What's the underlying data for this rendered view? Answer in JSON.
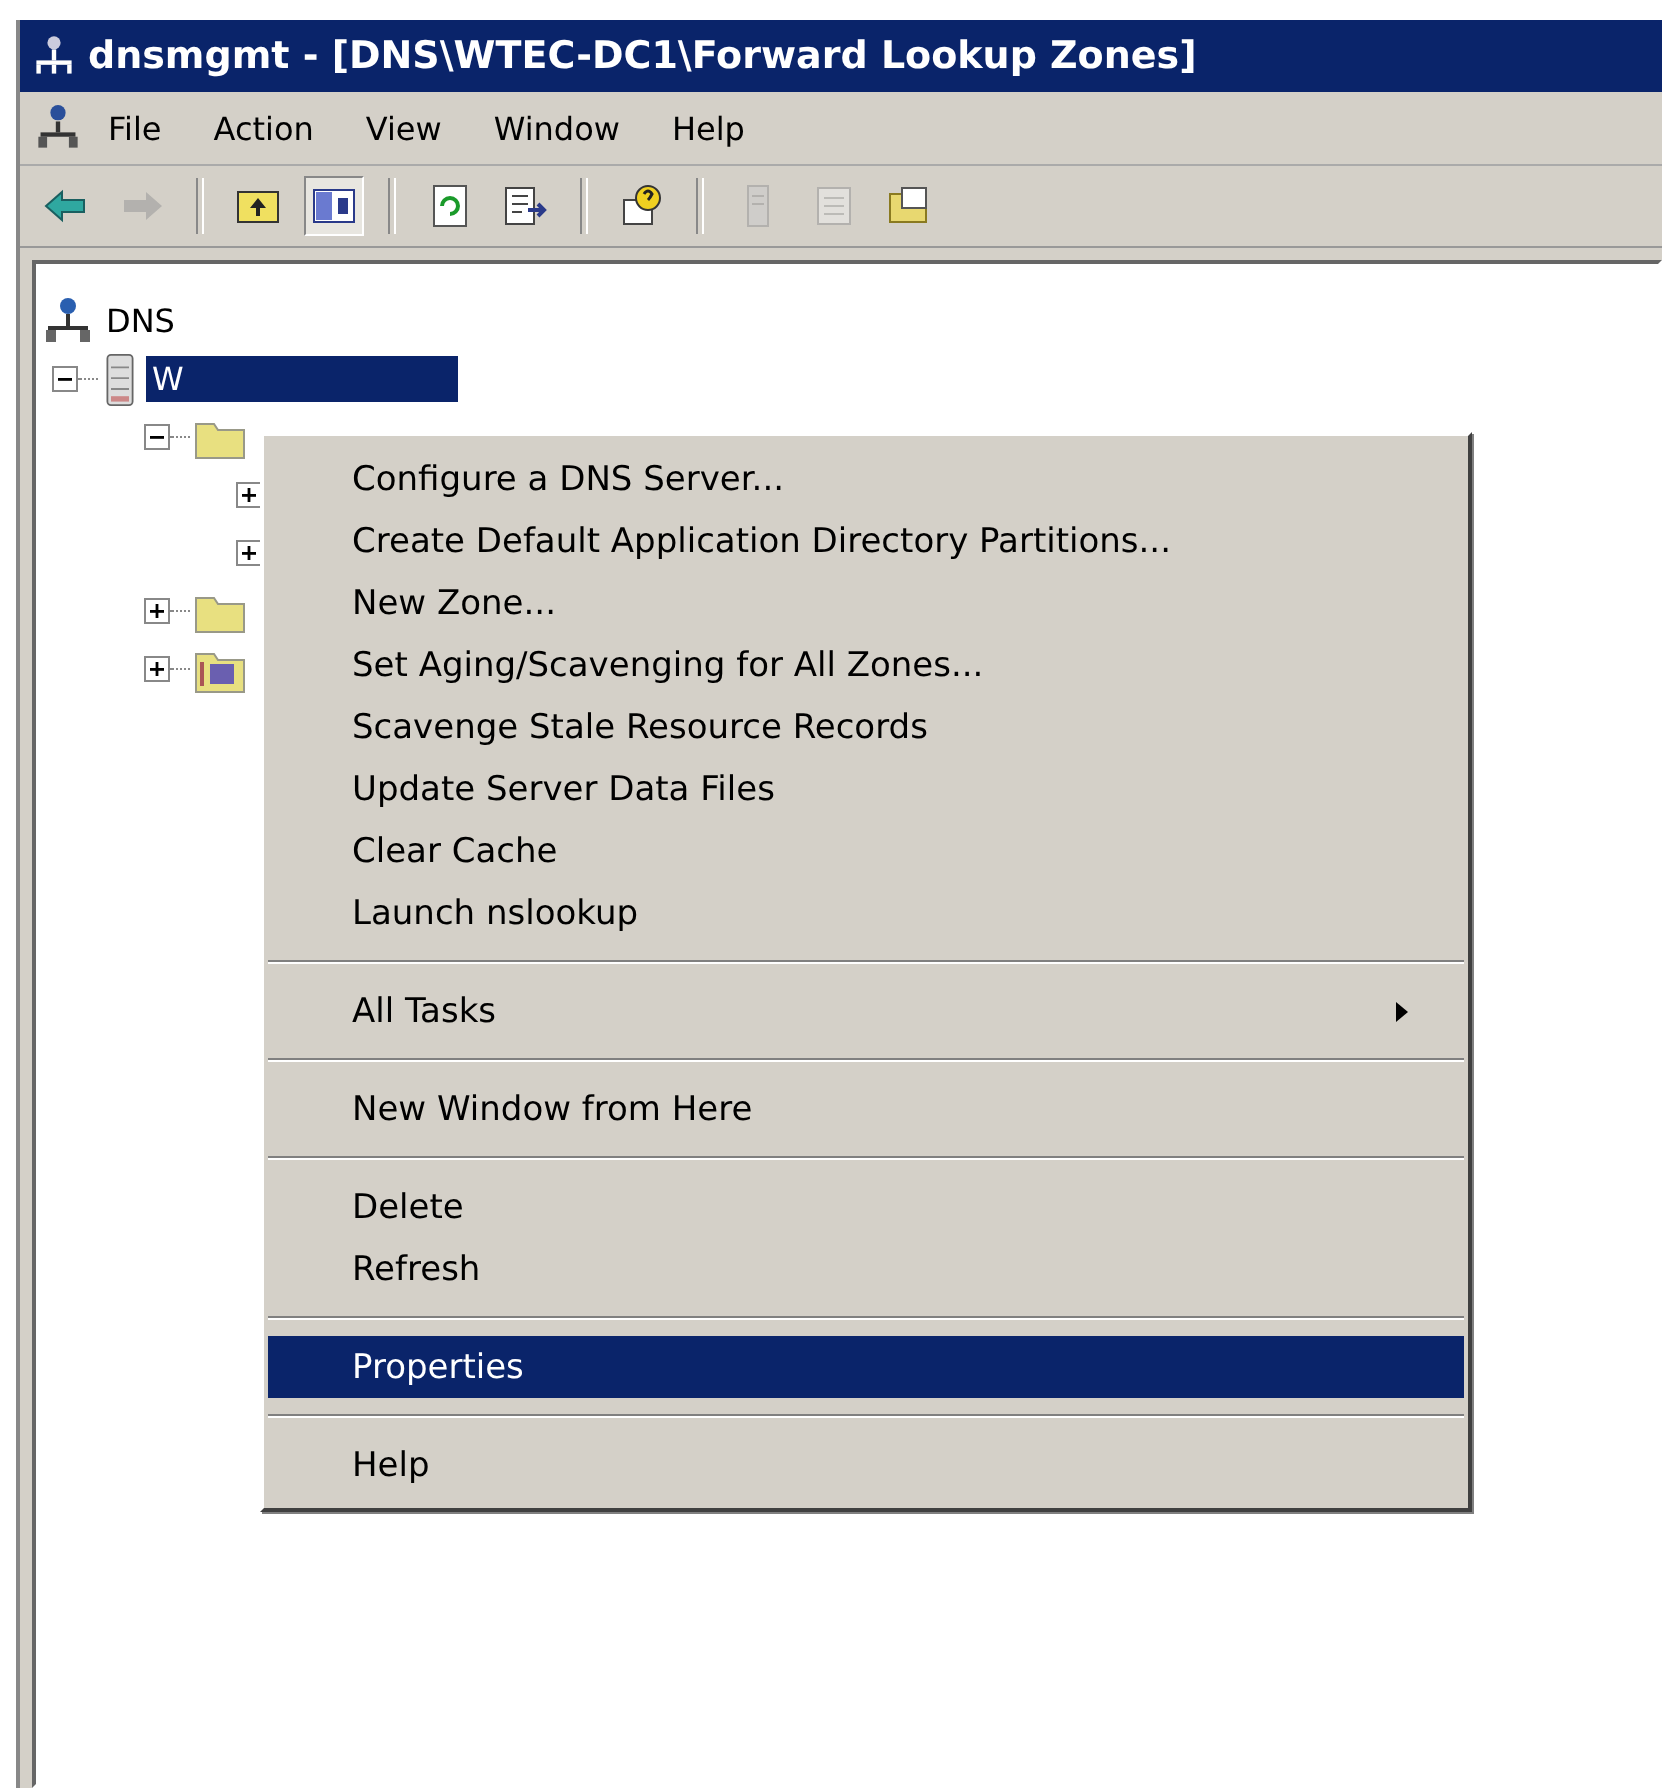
{
  "window": {
    "title": "dnsmgmt - [DNS\\WTEC-DC1\\Forward Lookup Zones]"
  },
  "menu_bar": [
    "File",
    "Action",
    "View",
    "Window",
    "Help"
  ],
  "toolbar": [
    {
      "kind": "back",
      "disabled": false,
      "pressed": false
    },
    {
      "kind": "forward",
      "disabled": true,
      "pressed": false
    },
    {
      "kind": "separator"
    },
    {
      "kind": "up",
      "disabled": false,
      "pressed": false
    },
    {
      "kind": "tree",
      "disabled": false,
      "pressed": true
    },
    {
      "kind": "separator"
    },
    {
      "kind": "refresh",
      "disabled": false,
      "pressed": false
    },
    {
      "kind": "export",
      "disabled": false,
      "pressed": false
    },
    {
      "kind": "separator"
    },
    {
      "kind": "help",
      "disabled": false,
      "pressed": false
    },
    {
      "kind": "separator"
    },
    {
      "kind": "server",
      "disabled": true,
      "pressed": false
    },
    {
      "kind": "list",
      "disabled": true,
      "pressed": false
    },
    {
      "kind": "folder",
      "disabled": false,
      "pressed": false
    }
  ],
  "tree": [
    {
      "kind": "dns",
      "label": "DNS",
      "selected": false,
      "children": [
        {
          "kind": "server",
          "label": "W",
          "selected": true,
          "expanded": true,
          "children": [
            {
              "kind": "folder",
              "expanded": true,
              "children": [
                {
                  "expanded": false
                },
                {
                  "expanded": false
                }
              ]
            },
            {
              "kind": "folder",
              "expanded": false
            },
            {
              "kind": "special",
              "expanded": false
            }
          ]
        }
      ]
    }
  ],
  "context_menu": [
    {
      "kind": "item",
      "label": "Configure a DNS Server...",
      "selected": false
    },
    {
      "kind": "item",
      "label": "Create Default Application Directory Partitions...",
      "selected": false
    },
    {
      "kind": "item",
      "label": "New Zone...",
      "selected": false
    },
    {
      "kind": "item",
      "label": "Set Aging/Scavenging for All Zones...",
      "selected": false
    },
    {
      "kind": "item",
      "label": "Scavenge Stale Resource Records",
      "selected": false
    },
    {
      "kind": "item",
      "label": "Update Server Data Files",
      "selected": false
    },
    {
      "kind": "item",
      "label": "Clear Cache",
      "selected": false
    },
    {
      "kind": "item",
      "label": "Launch nslookup",
      "selected": false
    },
    {
      "kind": "separator"
    },
    {
      "kind": "submenu",
      "label": "All Tasks",
      "selected": false
    },
    {
      "kind": "separator"
    },
    {
      "kind": "item",
      "label": "New Window from Here",
      "selected": false
    },
    {
      "kind": "separator"
    },
    {
      "kind": "item",
      "label": "Delete",
      "selected": false
    },
    {
      "kind": "item",
      "label": "Refresh",
      "selected": false
    },
    {
      "kind": "separator"
    },
    {
      "kind": "item",
      "label": "Properties",
      "selected": true
    },
    {
      "kind": "separator"
    },
    {
      "kind": "item",
      "label": "Help",
      "selected": false
    }
  ]
}
